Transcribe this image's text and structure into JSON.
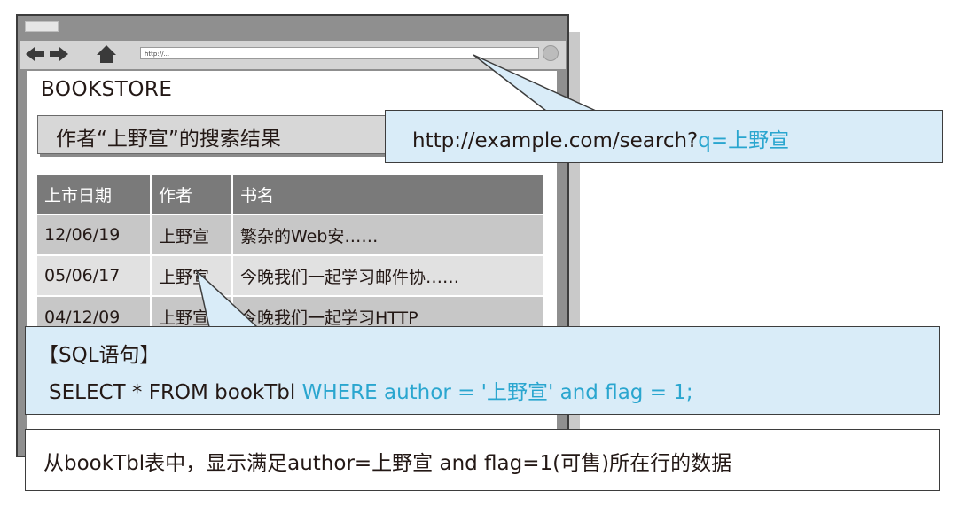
{
  "browser": {
    "address_text": "http://..."
  },
  "page": {
    "store_title": "BOOKSTORE",
    "result_header": "作者“上野宣”的搜索结果"
  },
  "table": {
    "headers": [
      "上市日期",
      "作者",
      "书名"
    ],
    "rows": [
      [
        "12/06/19",
        "上野宣",
        "繁杂的Web安……"
      ],
      [
        "05/06/17",
        "上野宣",
        "今晚我们一起学习邮件协……"
      ],
      [
        "04/12/09",
        "上野宣",
        "今晚我们一起学习HTTP"
      ]
    ]
  },
  "url_callout": {
    "prefix": "http://example.com/search?",
    "query": "q=上野宣"
  },
  "sql_callout": {
    "title": "【SQL语句】",
    "statement_plain": "SELECT * FROM bookTbl ",
    "statement_highlight": "WHERE author = '上野宣' and flag = 1;"
  },
  "explanation": {
    "text": "从bookTbl表中，显示满足author=上野宣 and flag=1(可售)所在行的数据"
  },
  "colors": {
    "callout_fill": "#d9ecf8",
    "accent": "#2aa6cf",
    "table_header": "#7a7a7a"
  },
  "icons": [
    "back-arrow-icon",
    "forward-arrow-icon",
    "home-icon"
  ]
}
